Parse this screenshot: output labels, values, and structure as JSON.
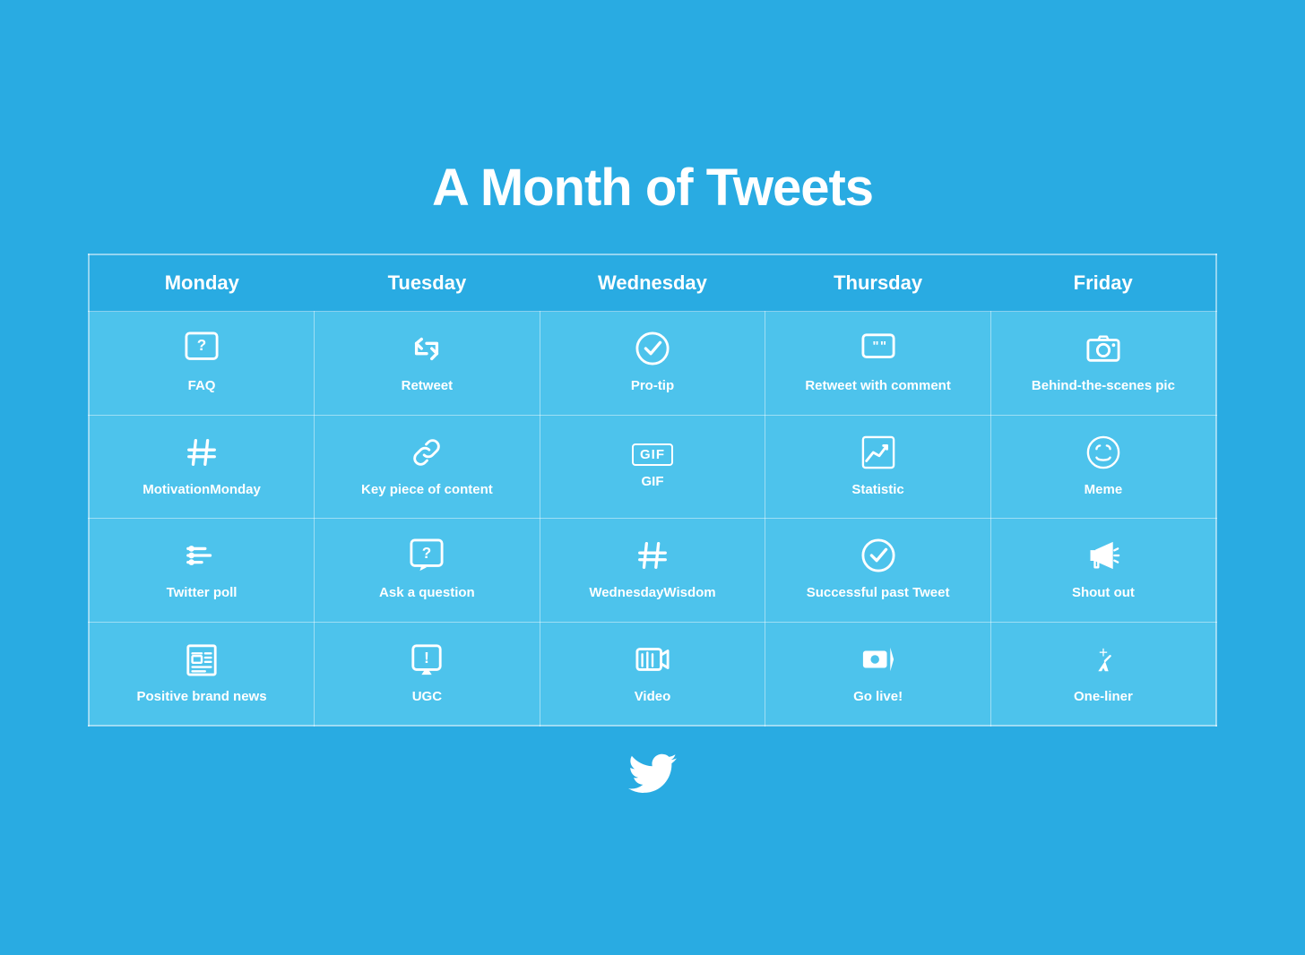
{
  "title": "A Month of Tweets",
  "columns": [
    "Monday",
    "Tuesday",
    "Wednesday",
    "Thursday",
    "Friday"
  ],
  "rows": [
    [
      {
        "icon": "faq",
        "label": "FAQ"
      },
      {
        "icon": "retweet",
        "label": "Retweet"
      },
      {
        "icon": "protip",
        "label": "Pro-tip"
      },
      {
        "icon": "retweet-comment",
        "label": "Retweet\nwith comment"
      },
      {
        "icon": "camera",
        "label": "Behind-the-scenes\npic"
      }
    ],
    [
      {
        "icon": "hashtag",
        "label": "MotivationMonday"
      },
      {
        "icon": "link",
        "label": "Key piece of content"
      },
      {
        "icon": "gif",
        "label": "GIF"
      },
      {
        "icon": "statistic",
        "label": "Statistic"
      },
      {
        "icon": "meme",
        "label": "Meme"
      }
    ],
    [
      {
        "icon": "poll",
        "label": "Twitter poll"
      },
      {
        "icon": "question",
        "label": "Ask a question"
      },
      {
        "icon": "hashtag2",
        "label": "WednesdayWisdom"
      },
      {
        "icon": "check",
        "label": "Successful past\nTweet"
      },
      {
        "icon": "megaphone",
        "label": "Shout out"
      }
    ],
    [
      {
        "icon": "news",
        "label": "Positive brand news"
      },
      {
        "icon": "ugc",
        "label": "UGC"
      },
      {
        "icon": "video",
        "label": "Video"
      },
      {
        "icon": "live",
        "label": "Go live!"
      },
      {
        "icon": "oneliner",
        "label": "One-liner"
      }
    ]
  ]
}
